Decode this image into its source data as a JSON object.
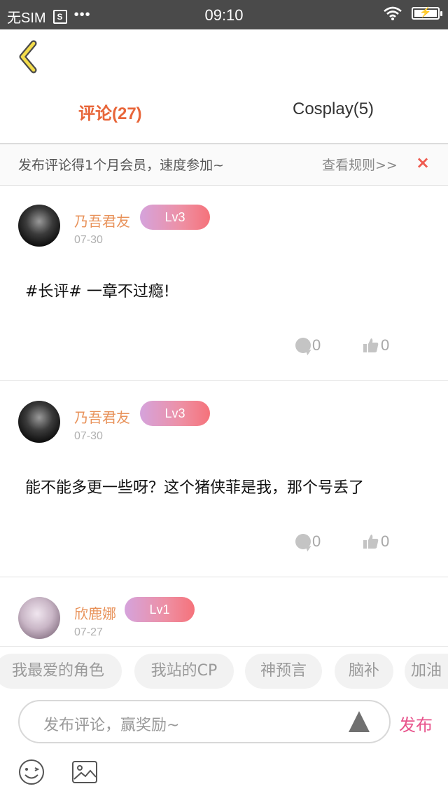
{
  "status_bar": {
    "carrier": "无SIM",
    "sim_icon_letter": "S",
    "dots": "•••",
    "time": "09:10",
    "icons": [
      "wifi-icon",
      "battery-charging-icon"
    ]
  },
  "header": {
    "back_icon": "chevron-left-icon",
    "tabs": [
      {
        "label": "评论(27)",
        "active": true
      },
      {
        "label": "Cosplay(5)",
        "active": false
      }
    ]
  },
  "notice": {
    "text": "发布评论得1个月会员，速度参加~",
    "rules_link": "查看规则>>",
    "close": "×"
  },
  "comments": [
    {
      "username": "乃吾君友",
      "level": "Lv3",
      "date": "07-30",
      "content": "#长评# 一章不过瘾!",
      "replies": "0",
      "likes": "0"
    },
    {
      "username": "乃吾君友",
      "level": "Lv3",
      "date": "07-30",
      "content": "能不能多更一些呀？这个猪侠菲是我，那个号丢了",
      "replies": "0",
      "likes": "0"
    },
    {
      "username": "欣鹿娜",
      "level": "Lv1",
      "date": "07-27"
    }
  ],
  "quick_tags": [
    "我最爱的角色",
    "我站的CP",
    "神预言",
    "脑补",
    "加油"
  ],
  "composer": {
    "placeholder": "发布评论，赢奖励~",
    "send_label": "发布",
    "icons": [
      "emoji-icon",
      "image-icon",
      "expand-icon"
    ]
  },
  "colors": {
    "accent_orange": "#e8663a",
    "username_orange": "#e8925a",
    "publish_pink": "#e8548c",
    "close_red": "#ef5a4f"
  }
}
